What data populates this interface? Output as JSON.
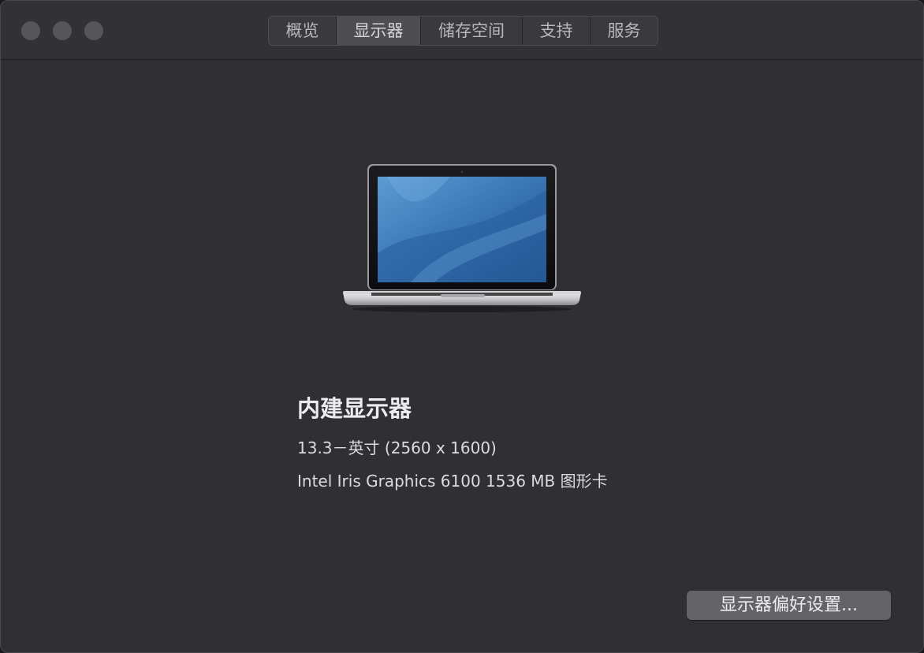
{
  "window": {
    "traffic_lights": [
      "close",
      "minimize",
      "zoom"
    ]
  },
  "tabs": [
    {
      "label": "概览",
      "active": false
    },
    {
      "label": "显示器",
      "active": true
    },
    {
      "label": "储存空间",
      "active": false
    },
    {
      "label": "支持",
      "active": false
    },
    {
      "label": "服务",
      "active": false
    }
  ],
  "display": {
    "icon": "macbook-pro-laptop-icon",
    "name": "内建显示器",
    "size": "13.3－英寸 (2560 x 1600)",
    "graphics": "Intel Iris Graphics 6100 1536 MB 图形卡"
  },
  "actions": {
    "prefs_button": "显示器偏好设置..."
  },
  "colors": {
    "window_bg": "#303034",
    "active_tab": "#4e4e52",
    "button_bg": "#646468",
    "screen_blue": "#3a6ea8"
  }
}
